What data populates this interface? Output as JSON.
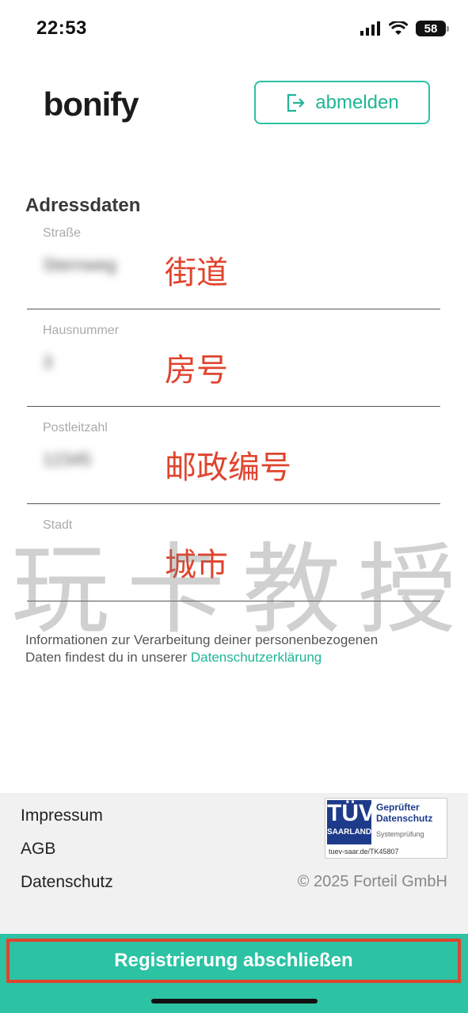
{
  "status_bar": {
    "time": "22:53",
    "battery": "58"
  },
  "header": {
    "logo": "bonify",
    "logout_label": "abmelden"
  },
  "form": {
    "title": "Adressdaten",
    "fields": [
      {
        "label": "Straße",
        "value": "Sternweg",
        "annotation": "街道"
      },
      {
        "label": "Hausnummer",
        "value": "3",
        "annotation": "房号"
      },
      {
        "label": "Postleitzahl",
        "value": "12345",
        "annotation": "邮政编号"
      },
      {
        "label": "Stadt",
        "value": "",
        "annotation": "城市"
      }
    ]
  },
  "watermark": "玩卡教授",
  "info": {
    "text_line1": "Informationen zur Verarbeitung deiner personenbezogenen",
    "text_line2": "Daten findest du in unserer ",
    "link": "Datenschutzerklärung"
  },
  "footer": {
    "links": [
      "Impressum",
      "AGB",
      "Datenschutz"
    ],
    "tuv": {
      "brand": "TÜV",
      "region": "SAARLAND",
      "title": "Geprüfter Datenschutz",
      "subtitle": "Systemprüfung",
      "url": "tuev-saar.de/TK45807"
    },
    "copyright": "© 2025 Forteil GmbH"
  },
  "cta": {
    "label": "Registrierung abschließen"
  },
  "colors": {
    "accent": "#2cc2a4",
    "annotation": "#e0442e",
    "tuv_blue": "#1d3b8a"
  }
}
